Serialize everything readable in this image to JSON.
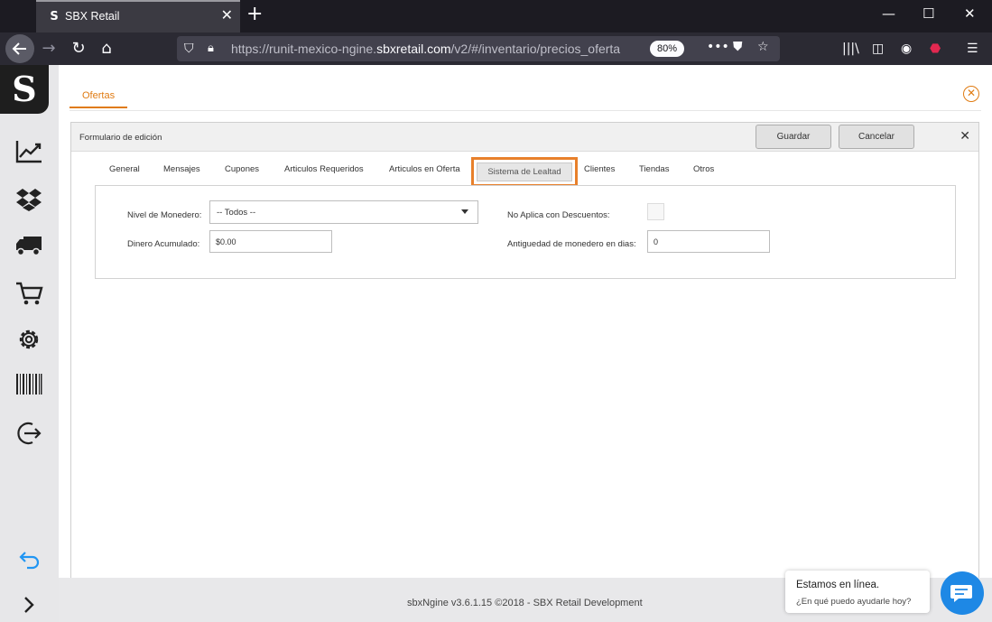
{
  "browser": {
    "tab_title": "SBX Retail",
    "favicon_letter": "S",
    "url_prefix": "https://runit-mexico-ngine.",
    "url_host": "sbxretail.com",
    "url_path": "/v2/#/inventario/precios_oferta",
    "zoom": "80%"
  },
  "sidebar": {
    "logo_text": "S",
    "items": [
      {
        "icon": "chart-icon"
      },
      {
        "icon": "dropbox-icon"
      },
      {
        "icon": "truck-icon"
      },
      {
        "icon": "cart-icon"
      },
      {
        "icon": "gear-icon"
      },
      {
        "icon": "barcode-icon"
      },
      {
        "icon": "logout-icon"
      }
    ],
    "accent": "#2196f3"
  },
  "page": {
    "tab_label": "Ofertas",
    "accent": "#e07b12"
  },
  "form": {
    "title": "Formulario de edición",
    "save_label": "Guardar",
    "cancel_label": "Cancelar",
    "tabs": [
      {
        "label": "General"
      },
      {
        "label": "Mensajes"
      },
      {
        "label": "Cupones"
      },
      {
        "label": "Articulos Requeridos"
      },
      {
        "label": "Articulos en Oferta"
      },
      {
        "label": "Sistema de Lealtad"
      },
      {
        "label": "Clientes"
      },
      {
        "label": "Tiendas"
      },
      {
        "label": "Otros"
      }
    ],
    "fields": {
      "nivel_label": "Nivel de Monedero:",
      "nivel_value": "-- Todos --",
      "dinero_label": "Dinero Acumulado:",
      "dinero_value": "$0.00",
      "no_aplica_label": "No Aplica con Descuentos:",
      "antiguedad_label": "Antiguedad de monedero en dias:",
      "antiguedad_value": "0"
    }
  },
  "footer": {
    "text": "sbxNgine v3.6.1.15 ©2018 - SBX Retail Development"
  },
  "chat": {
    "title": "Estamos en línea.",
    "subtitle": "¿En qué puedo ayudarle hoy?"
  }
}
